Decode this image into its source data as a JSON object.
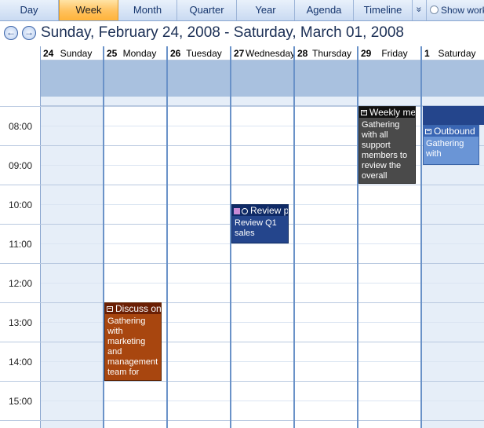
{
  "views": {
    "day": "Day",
    "week": "Week",
    "month": "Month",
    "quarter": "Quarter",
    "year": "Year",
    "agenda": "Agenda",
    "timeline": "Timeline",
    "more": "»",
    "show_work": "Show work"
  },
  "header": {
    "prev": "←",
    "next": "→",
    "range": "Sunday, February 24, 2008 - Saturday, March 01, 2008"
  },
  "days": [
    {
      "num": "24",
      "name": "Sunday"
    },
    {
      "num": "25",
      "name": "Monday"
    },
    {
      "num": "26",
      "name": "Tuesday"
    },
    {
      "num": "27",
      "name": "Wednesday"
    },
    {
      "num": "28",
      "name": "Thursday"
    },
    {
      "num": "29",
      "name": "Friday"
    },
    {
      "num": "1",
      "name": "Saturday"
    }
  ],
  "hours": [
    "08:00",
    "09:00",
    "10:00",
    "11:00",
    "12:00",
    "13:00",
    "14:00",
    "15:00"
  ],
  "appointments": [
    {
      "title": "Weekly mee",
      "body": "Gathering with all support members to review the overall",
      "color": "#4a4a4a"
    },
    {
      "title": "Outbound",
      "body": "Gathering with",
      "color": "#6a95d6"
    },
    {
      "title": "Review pe",
      "body": "Review Q1 sales",
      "color": "#24458c"
    },
    {
      "title": "Discuss on",
      "body": "Gathering with marketing and management team for",
      "color": "#a8460f"
    }
  ],
  "colors": {
    "accent": "#ffc15c",
    "allday": "#a9c1df",
    "weekend": "#e6eef8",
    "divider": "#6a92c8"
  }
}
